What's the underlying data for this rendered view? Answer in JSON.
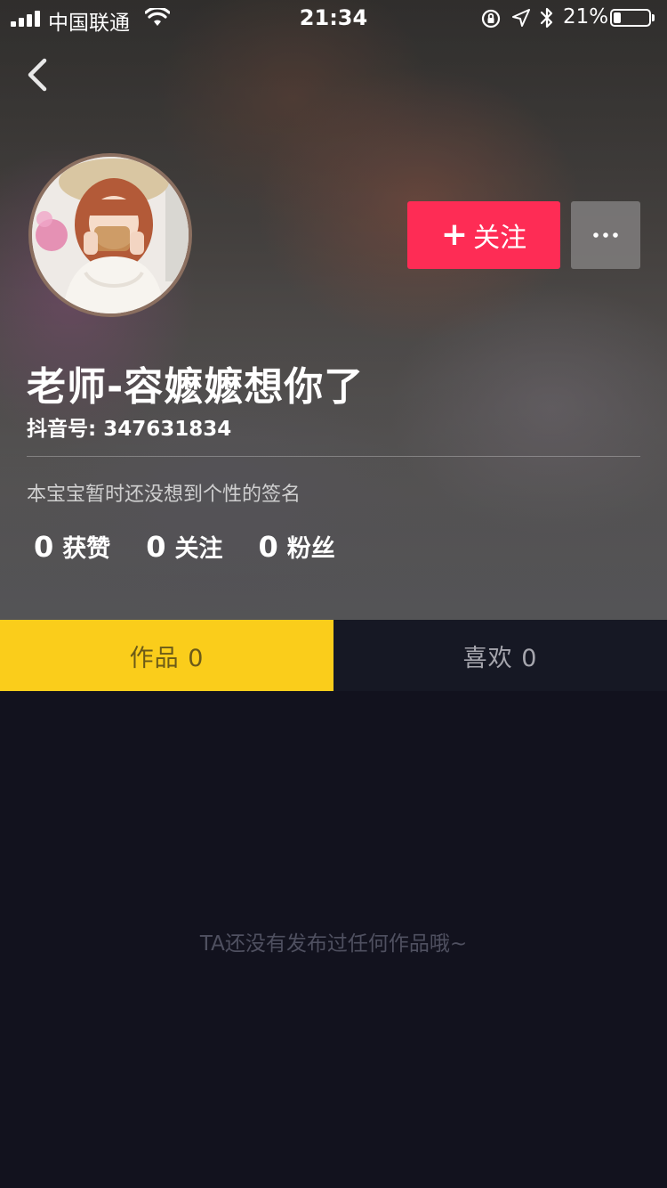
{
  "status_bar": {
    "carrier": "中国联通",
    "time": "21:34",
    "battery_percent": "21%",
    "battery_level": 0.21
  },
  "profile": {
    "nickname": "老师-容嬷嬷想你了",
    "douyin_id": "抖音号: 347631834",
    "signature": "本宝宝暂时还没想到个性的签名",
    "follow_label": "关注",
    "follow_plus": "+"
  },
  "stats": [
    {
      "value": "0",
      "label": "获赞"
    },
    {
      "value": "0",
      "label": "关注"
    },
    {
      "value": "0",
      "label": "粉丝"
    }
  ],
  "tabs": [
    {
      "label": "作品 0",
      "active": true
    },
    {
      "label": "喜欢 0",
      "active": false
    }
  ],
  "empty_message": "TA还没有发布过任何作品哦~",
  "colors": {
    "follow_accent": "#fe2c55",
    "active_tab": "#facd1b",
    "background": "#12121e"
  }
}
